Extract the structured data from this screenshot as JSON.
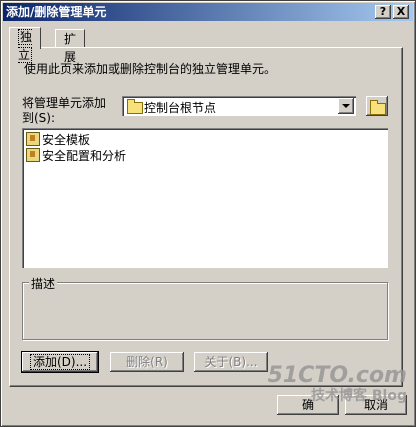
{
  "window": {
    "title": "添加/删除管理单元",
    "help_button": "?",
    "close_button": "X"
  },
  "tabs": [
    {
      "label": "独立",
      "active": true
    },
    {
      "label": "扩展",
      "active": false
    }
  ],
  "panel": {
    "description": "使用此页来添加或删除控制台的独立管理单元。",
    "add_to_label_line1": "将管理单元添加",
    "add_to_label_line2": "到(S):",
    "add_to_value": "控制台根节点",
    "snapins": [
      {
        "label": "安全模板"
      },
      {
        "label": "安全配置和分析"
      }
    ],
    "description_group_label": "描述",
    "buttons": {
      "add": "添加(D)...",
      "remove": "删除(R)",
      "about": "关于(B)..."
    }
  },
  "footer": {
    "ok_partial": "确",
    "cancel_partial": "取消"
  },
  "watermark": {
    "line1": "51CTO.com",
    "line2": "技术博客 Blog"
  },
  "colors": {
    "face": "#d4d0c8",
    "title_start": "#0a246a",
    "title_end": "#a6caf0"
  }
}
